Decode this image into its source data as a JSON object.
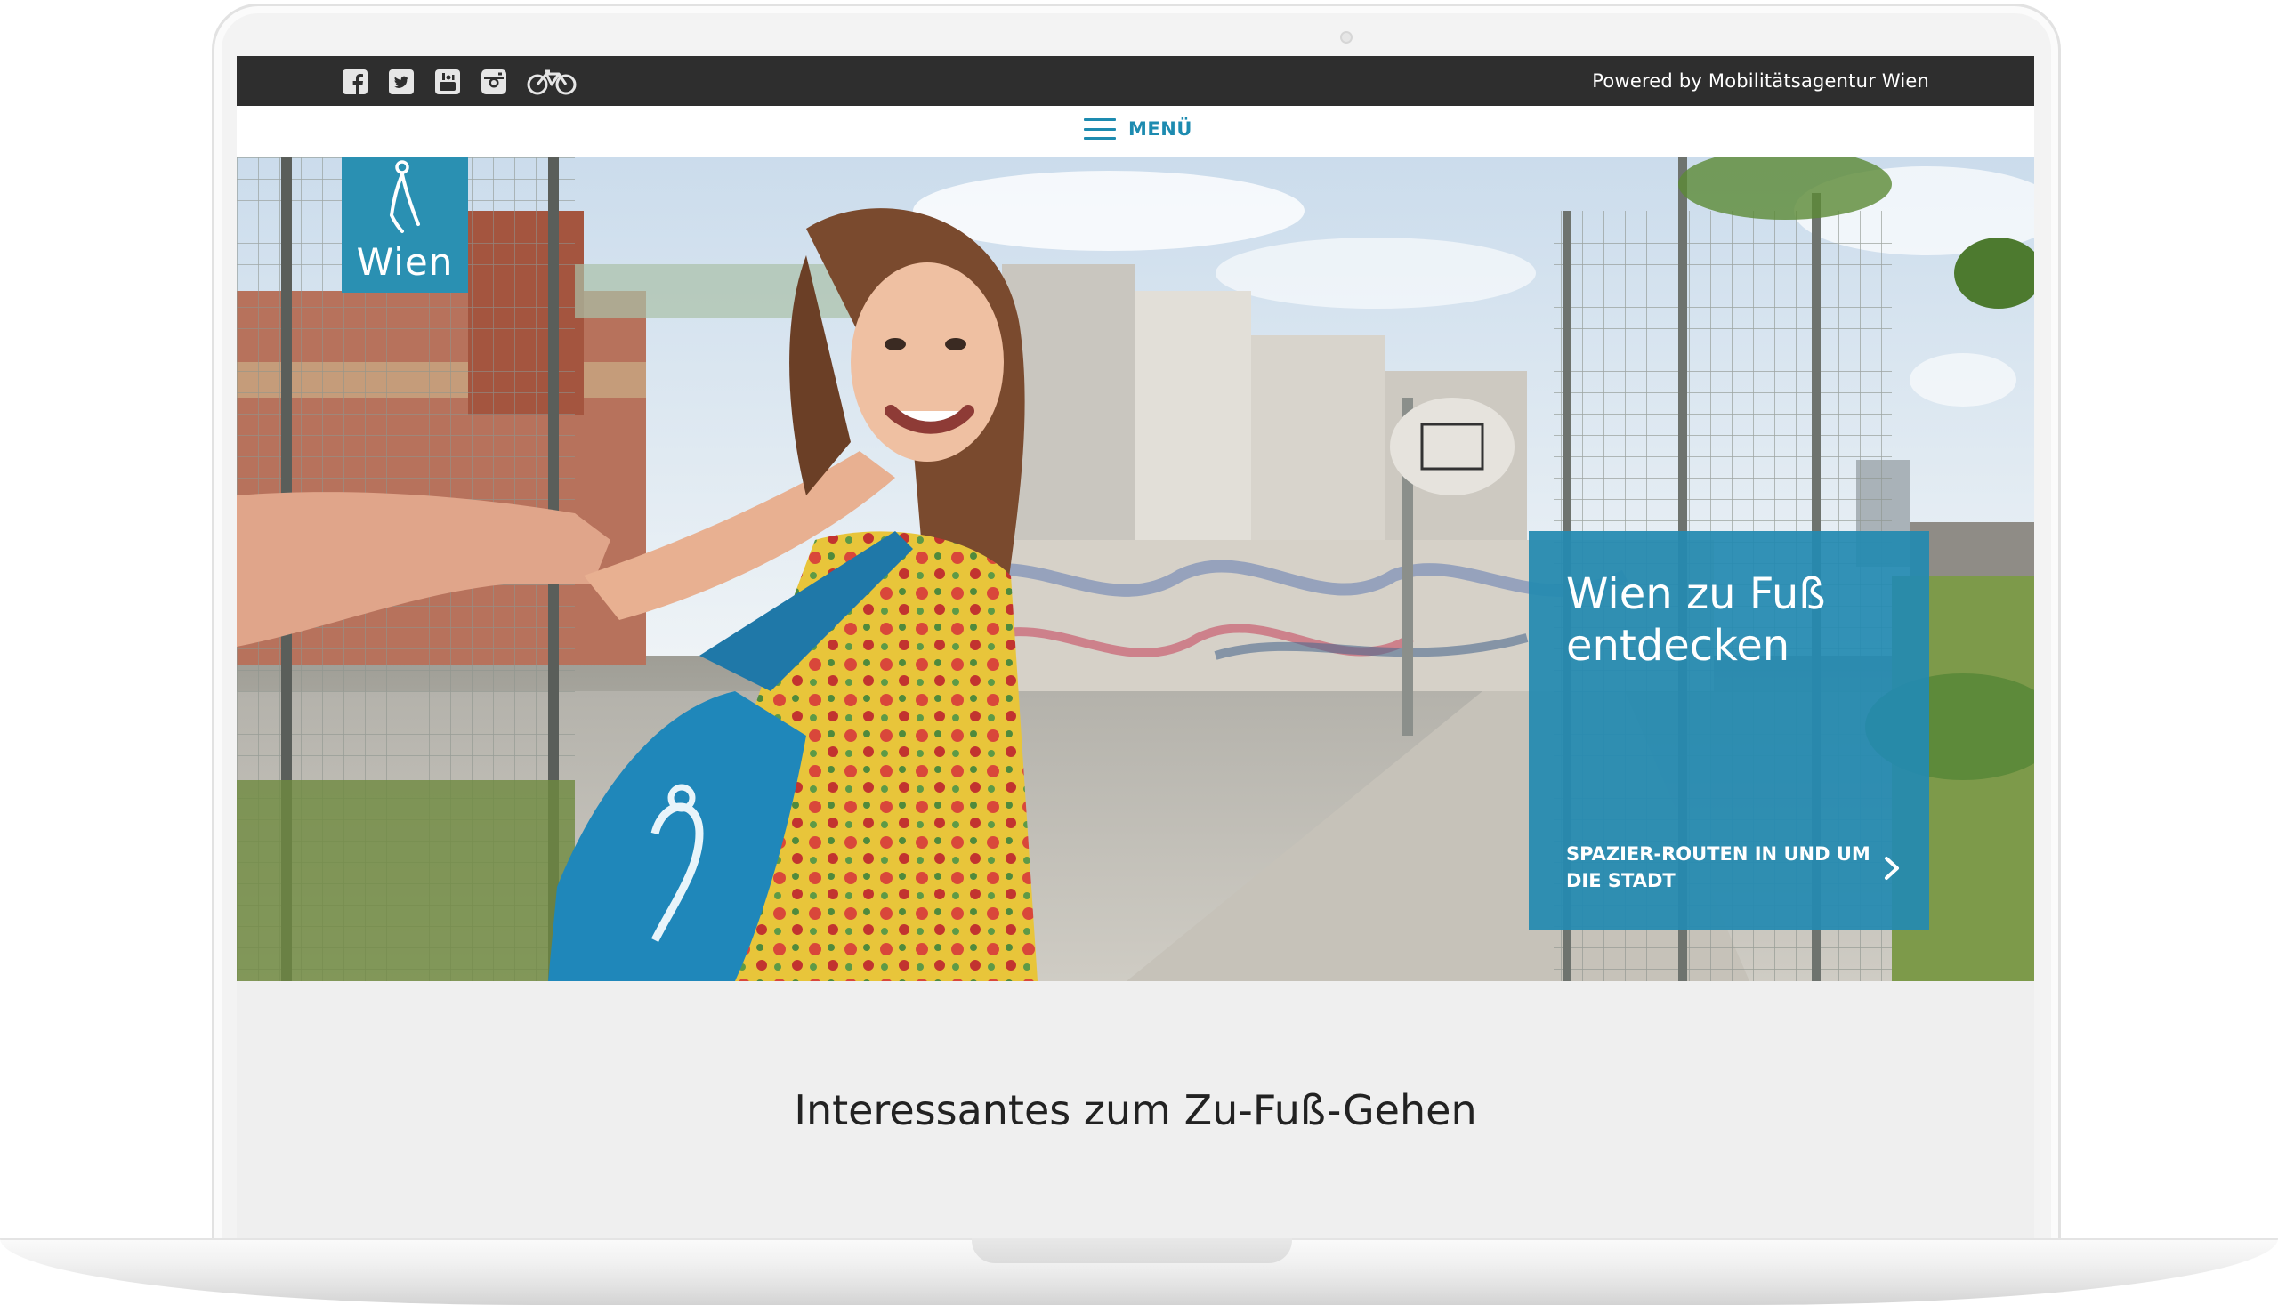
{
  "topbar": {
    "social_icons": [
      "facebook-icon",
      "twitter-icon",
      "youtube-icon",
      "instagram-icon",
      "bicycle-icon"
    ],
    "powered_by": "Powered by Mobilitätsagentur Wien"
  },
  "menu": {
    "label": "MENÜ"
  },
  "logo": {
    "text": "Wien"
  },
  "hero": {
    "teaser_title": "Wien zu Fuß entdecken",
    "teaser_link": "SPAZIER-ROUTEN IN UND UM DIE STADT"
  },
  "main": {
    "section_title": "Interessantes zum Zu-Fuß-Gehen"
  },
  "colors": {
    "brand_blue": "#2a90b2",
    "topbar_bg": "#2e2e2e",
    "page_bg": "#efefef"
  }
}
